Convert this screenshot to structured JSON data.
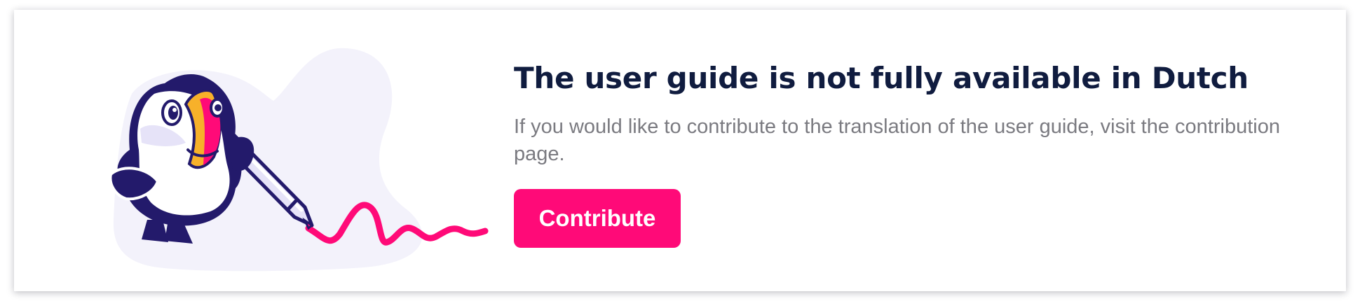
{
  "notice": {
    "title": "The user guide is not fully available in Dutch",
    "message": "If you would like to contribute to the translation of the user guide, visit the contribution page.",
    "button_label": "Contribute"
  },
  "illustration": {
    "name": "puffin-writing-illustration",
    "colors": {
      "navy": "#231a6b",
      "beak_pink": "#ff0a78",
      "beak_orange": "#f7b12a",
      "background_blob": "#f3f2fb",
      "pen_body": "#e6e3f8"
    }
  },
  "colors": {
    "title": "#101c3f",
    "message": "#7a7a80",
    "accent": "#ff0a78",
    "button_text": "#ffffff"
  }
}
